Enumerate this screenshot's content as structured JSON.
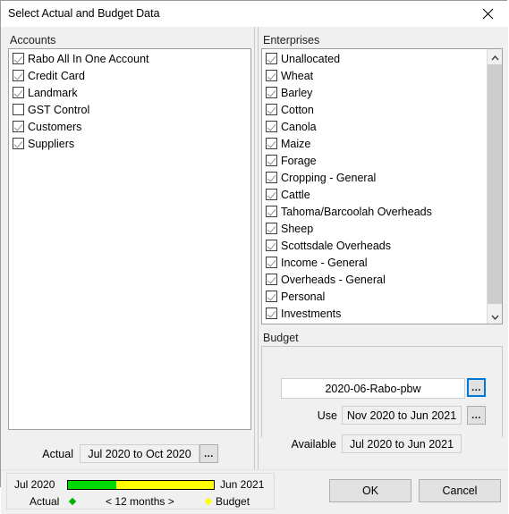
{
  "window": {
    "title": "Select Actual and Budget Data",
    "close_icon": "close-icon"
  },
  "accounts": {
    "group_label": "Accounts",
    "items": [
      {
        "label": "Rabo All In One Account",
        "checked": true
      },
      {
        "label": "Credit Card",
        "checked": true
      },
      {
        "label": "Landmark",
        "checked": true
      },
      {
        "label": "GST Control",
        "checked": false
      },
      {
        "label": "Customers",
        "checked": true
      },
      {
        "label": "Suppliers",
        "checked": true
      }
    ],
    "actual_label": "Actual",
    "actual_value": "Jul 2020 to Oct 2020",
    "actual_dots": "..."
  },
  "enterprises": {
    "group_label": "Enterprises",
    "items": [
      {
        "label": "Unallocated",
        "checked": true
      },
      {
        "label": "Wheat",
        "checked": true
      },
      {
        "label": "Barley",
        "checked": true
      },
      {
        "label": "Cotton",
        "checked": true
      },
      {
        "label": "Canola",
        "checked": true
      },
      {
        "label": "Maize",
        "checked": true
      },
      {
        "label": "Forage",
        "checked": true
      },
      {
        "label": "Cropping - General",
        "checked": true
      },
      {
        "label": "Cattle",
        "checked": true
      },
      {
        "label": "Tahoma/Barcoolah Overheads",
        "checked": true
      },
      {
        "label": "Sheep",
        "checked": true
      },
      {
        "label": "Scottsdale Overheads",
        "checked": true
      },
      {
        "label": "Income - General",
        "checked": true
      },
      {
        "label": "Overheads - General",
        "checked": true
      },
      {
        "label": "Personal",
        "checked": true
      },
      {
        "label": "Investments",
        "checked": true
      },
      {
        "label": "",
        "checked": false
      }
    ],
    "scrollbar": {
      "up_icon": "chevron-up-icon",
      "down_icon": "chevron-down-icon"
    }
  },
  "budget": {
    "group_label": "Budget",
    "name_value": "2020-06-Rabo-pbw",
    "name_dots": "...",
    "use_label": "Use",
    "use_value": "Nov 2020 to Jun 2021",
    "use_dots": "...",
    "available_label": "Available",
    "available_value": "Jul 2020 to Jun 2021"
  },
  "status": {
    "range_start": "Jul 2020",
    "range_end": "Jun 2021",
    "legend_actual": "Actual",
    "legend_budget": "Budget",
    "months_label": "< 12 months >",
    "actual_color": "#00b200",
    "budget_color": "#ffff00",
    "bar_green_color": "#00d900",
    "bar_yellow_color": "#ffff00",
    "green_percent": 33
  },
  "footer": {
    "ok_label": "OK",
    "cancel_label": "Cancel"
  }
}
